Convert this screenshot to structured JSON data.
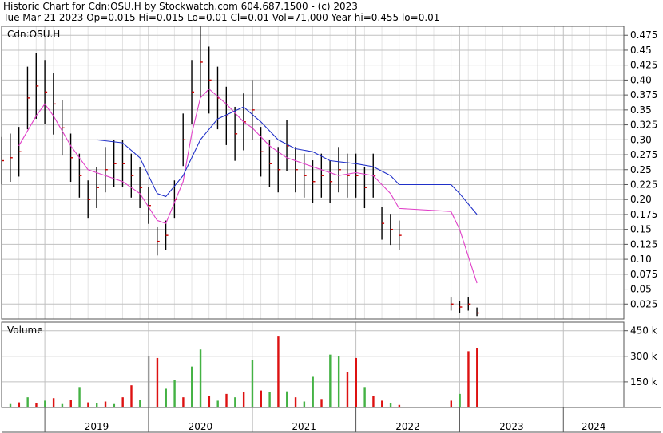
{
  "header": {
    "title": "Historic Chart for Cdn:OSU.H by Stockwatch.com 604.687.1500 - (c) 2023",
    "summary": "Tue Mar 21 2023  Op=0.015  Hi=0.015  Lo=0.01  Cl=0.01  Vol=71,000  Year hi=0.455  lo=0.01"
  },
  "colors": {
    "background": "#ffffff",
    "grid": "#c0c0c0",
    "frame": "#555555",
    "price_bar": "#000000",
    "price_bar_red": "#cc0000",
    "ma_short": "#e040c8",
    "ma_long": "#2030c8",
    "volume_up": "#44b244",
    "volume_down": "#dd1111",
    "volume_neutral": "#999999"
  },
  "chart_data": [
    {
      "type": "line",
      "panel": "price",
      "label": "Cdn:OSU.H",
      "y_ticks": [
        "0.475",
        "0.45",
        "0.425",
        "0.40",
        "0.375",
        "0.35",
        "0.325",
        "0.30",
        "0.275",
        "0.25",
        "0.225",
        "0.20",
        "0.175",
        "0.15",
        "0.125",
        "0.10",
        "0.075",
        "0.05",
        "0.025"
      ],
      "ylim": [
        0.0,
        0.49
      ],
      "x_labels": [
        "2019",
        "2020",
        "2021",
        "2022",
        "2023",
        "2024"
      ],
      "x_domain": [
        "2018-08",
        "2024-08"
      ],
      "grid": true,
      "price_points": [
        [
          "2018-08",
          0.265
        ],
        [
          "2018-09",
          0.27
        ],
        [
          "2018-10",
          0.28
        ],
        [
          "2018-11",
          0.37
        ],
        [
          "2018-12",
          0.39
        ],
        [
          "2019-01",
          0.38
        ],
        [
          "2019-02",
          0.36
        ],
        [
          "2019-03",
          0.32
        ],
        [
          "2019-04",
          0.27
        ],
        [
          "2019-05",
          0.24
        ],
        [
          "2019-06",
          0.2
        ],
        [
          "2019-07",
          0.22
        ],
        [
          "2019-08",
          0.25
        ],
        [
          "2019-09",
          0.26
        ],
        [
          "2019-10",
          0.26
        ],
        [
          "2019-11",
          0.24
        ],
        [
          "2019-12",
          0.22
        ],
        [
          "2020-01",
          0.19
        ],
        [
          "2020-02",
          0.13
        ],
        [
          "2020-03",
          0.14
        ],
        [
          "2020-04",
          0.2
        ],
        [
          "2020-05",
          0.3
        ],
        [
          "2020-06",
          0.38
        ],
        [
          "2020-07",
          0.43
        ],
        [
          "2020-08",
          0.4
        ],
        [
          "2020-09",
          0.37
        ],
        [
          "2020-10",
          0.34
        ],
        [
          "2020-11",
          0.31
        ],
        [
          "2020-12",
          0.33
        ],
        [
          "2021-01",
          0.35
        ],
        [
          "2021-02",
          0.28
        ],
        [
          "2021-03",
          0.26
        ],
        [
          "2021-04",
          0.25
        ],
        [
          "2021-05",
          0.29
        ],
        [
          "2021-06",
          0.25
        ],
        [
          "2021-07",
          0.24
        ],
        [
          "2021-08",
          0.23
        ],
        [
          "2021-09",
          0.24
        ],
        [
          "2021-10",
          0.23
        ],
        [
          "2021-11",
          0.25
        ],
        [
          "2021-12",
          0.24
        ],
        [
          "2022-01",
          0.24
        ],
        [
          "2022-02",
          0.22
        ],
        [
          "2022-03",
          0.24
        ],
        [
          "2022-04",
          0.16
        ],
        [
          "2022-05",
          0.15
        ],
        [
          "2022-06",
          0.14
        ]
      ],
      "price_points_late": [
        [
          "2022-12",
          0.025
        ],
        [
          "2023-01",
          0.02
        ],
        [
          "2023-02",
          0.025
        ],
        [
          "2023-03",
          0.01
        ]
      ],
      "series": [
        {
          "name": "",
          "role": "short-moving-average",
          "points": [
            [
              "2018-10",
              0.29
            ],
            [
              "2018-12",
              0.34
            ],
            [
              "2019-01",
              0.36
            ],
            [
              "2019-02",
              0.34
            ],
            [
              "2019-04",
              0.29
            ],
            [
              "2019-06",
              0.25
            ],
            [
              "2019-08",
              0.24
            ],
            [
              "2019-10",
              0.23
            ],
            [
              "2019-12",
              0.21
            ],
            [
              "2020-02",
              0.165
            ],
            [
              "2020-03",
              0.16
            ],
            [
              "2020-05",
              0.23
            ],
            [
              "2020-06",
              0.31
            ],
            [
              "2020-07",
              0.37
            ],
            [
              "2020-08",
              0.385
            ],
            [
              "2020-10",
              0.36
            ],
            [
              "2020-12",
              0.33
            ],
            [
              "2021-01",
              0.32
            ],
            [
              "2021-03",
              0.29
            ],
            [
              "2021-05",
              0.27
            ],
            [
              "2021-07",
              0.26
            ],
            [
              "2021-09",
              0.25
            ],
            [
              "2021-11",
              0.24
            ],
            [
              "2022-01",
              0.245
            ],
            [
              "2022-03",
              0.24
            ],
            [
              "2022-05",
              0.21
            ],
            [
              "2022-06",
              0.185
            ],
            [
              "2022-12",
              0.18
            ],
            [
              "2023-01",
              0.15
            ],
            [
              "2023-03",
              0.06
            ]
          ]
        },
        {
          "name": "",
          "role": "long-moving-average",
          "points": [
            [
              "2019-07",
              0.3
            ],
            [
              "2019-10",
              0.295
            ],
            [
              "2019-12",
              0.27
            ],
            [
              "2020-02",
              0.21
            ],
            [
              "2020-03",
              0.205
            ],
            [
              "2020-05",
              0.24
            ],
            [
              "2020-07",
              0.3
            ],
            [
              "2020-09",
              0.335
            ],
            [
              "2020-12",
              0.355
            ],
            [
              "2021-02",
              0.33
            ],
            [
              "2021-04",
              0.3
            ],
            [
              "2021-06",
              0.285
            ],
            [
              "2021-08",
              0.28
            ],
            [
              "2021-10",
              0.265
            ],
            [
              "2022-01",
              0.26
            ],
            [
              "2022-03",
              0.255
            ],
            [
              "2022-05",
              0.24
            ],
            [
              "2022-06",
              0.225
            ],
            [
              "2022-12",
              0.225
            ],
            [
              "2023-01",
              0.21
            ],
            [
              "2023-03",
              0.175
            ]
          ]
        }
      ]
    },
    {
      "type": "bar",
      "panel": "volume",
      "label": "Volume",
      "y_ticks": [
        "450 k",
        "300 k",
        "150 k"
      ],
      "ylim": [
        0,
        500
      ],
      "unit": "k",
      "bars": [
        [
          "2018-09",
          20,
          "up"
        ],
        [
          "2018-10",
          30,
          "down"
        ],
        [
          "2018-11",
          60,
          "up"
        ],
        [
          "2018-12",
          25,
          "down"
        ],
        [
          "2019-01",
          40,
          "up"
        ],
        [
          "2019-02",
          55,
          "down"
        ],
        [
          "2019-03",
          20,
          "up"
        ],
        [
          "2019-04",
          45,
          "down"
        ],
        [
          "2019-05",
          120,
          "up"
        ],
        [
          "2019-06",
          30,
          "down"
        ],
        [
          "2019-07",
          25,
          "up"
        ],
        [
          "2019-08",
          35,
          "down"
        ],
        [
          "2019-09",
          20,
          "up"
        ],
        [
          "2019-10",
          60,
          "down"
        ],
        [
          "2019-11",
          130,
          "down"
        ],
        [
          "2019-12",
          45,
          "up"
        ],
        [
          "2020-01",
          300,
          "neutral"
        ],
        [
          "2020-02",
          290,
          "down"
        ],
        [
          "2020-03",
          110,
          "up"
        ],
        [
          "2020-04",
          160,
          "up"
        ],
        [
          "2020-05",
          60,
          "down"
        ],
        [
          "2020-06",
          240,
          "up"
        ],
        [
          "2020-07",
          340,
          "up"
        ],
        [
          "2020-08",
          70,
          "down"
        ],
        [
          "2020-09",
          40,
          "up"
        ],
        [
          "2020-10",
          80,
          "down"
        ],
        [
          "2020-11",
          60,
          "up"
        ],
        [
          "2020-12",
          90,
          "down"
        ],
        [
          "2021-01",
          280,
          "up"
        ],
        [
          "2021-02",
          100,
          "down"
        ],
        [
          "2021-03",
          90,
          "up"
        ],
        [
          "2021-04",
          420,
          "down"
        ],
        [
          "2021-05",
          95,
          "up"
        ],
        [
          "2021-06",
          60,
          "down"
        ],
        [
          "2021-07",
          35,
          "up"
        ],
        [
          "2021-08",
          180,
          "up"
        ],
        [
          "2021-09",
          50,
          "down"
        ],
        [
          "2021-10",
          310,
          "up"
        ],
        [
          "2021-11",
          300,
          "up"
        ],
        [
          "2021-12",
          210,
          "down"
        ],
        [
          "2022-01",
          290,
          "down"
        ],
        [
          "2022-02",
          120,
          "up"
        ],
        [
          "2022-03",
          70,
          "down"
        ],
        [
          "2022-04",
          40,
          "down"
        ],
        [
          "2022-05",
          25,
          "up"
        ],
        [
          "2022-06",
          15,
          "down"
        ],
        [
          "2022-12",
          40,
          "down"
        ],
        [
          "2023-01",
          80,
          "up"
        ],
        [
          "2023-02",
          330,
          "down"
        ],
        [
          "2023-03",
          350,
          "down"
        ]
      ]
    }
  ]
}
